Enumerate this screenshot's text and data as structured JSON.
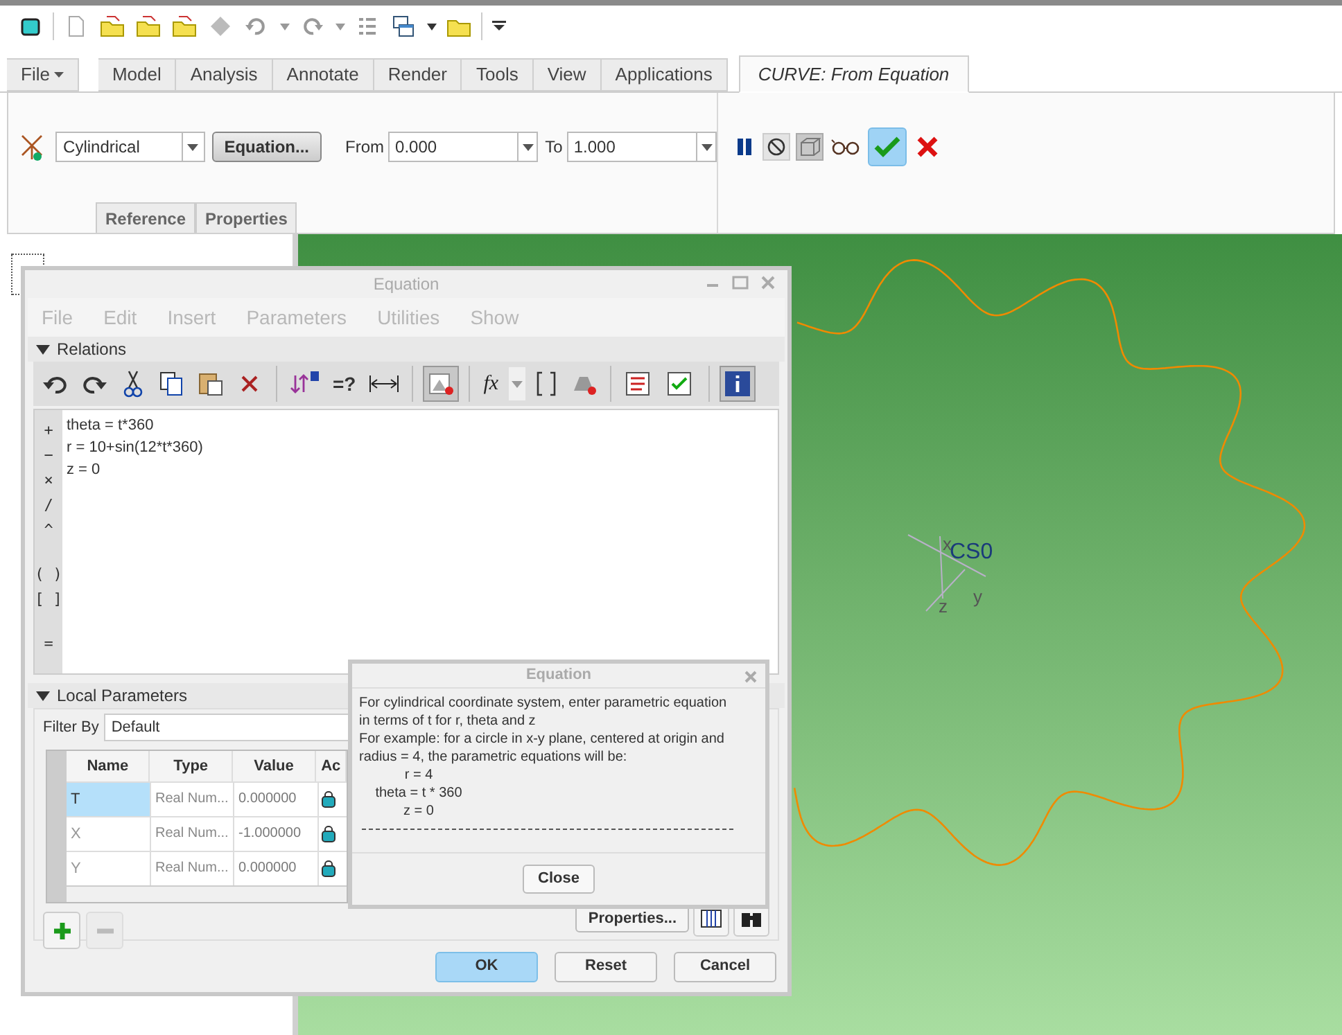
{
  "ribbon": {
    "tabs": [
      {
        "label": "File",
        "kind": "menu",
        "selected": false
      },
      {
        "label": "Model",
        "kind": "tab",
        "selected": false
      },
      {
        "label": "Analysis",
        "kind": "tab",
        "selected": false
      },
      {
        "label": "Annotate",
        "kind": "tab",
        "selected": false
      },
      {
        "label": "Render",
        "kind": "tab",
        "selected": false
      },
      {
        "label": "Tools",
        "kind": "tab",
        "selected": false
      },
      {
        "label": "View",
        "kind": "tab",
        "selected": false
      },
      {
        "label": "Applications",
        "kind": "tab",
        "selected": false
      },
      {
        "label": "CURVE: From Equation",
        "kind": "tab",
        "selected": true
      }
    ],
    "coordinate_system": {
      "value": "Cylindrical"
    },
    "equation_button": "Equation...",
    "from": {
      "label": "From",
      "value": "0.000"
    },
    "to": {
      "label": "To",
      "value": "1.000"
    },
    "panel_tabs": [
      "Reference",
      "Properties"
    ]
  },
  "equation_dialog": {
    "title": "Equation",
    "menu": [
      {
        "label": "File",
        "disabled": true
      },
      {
        "label": "Edit",
        "disabled": true
      },
      {
        "label": "Insert",
        "disabled": true
      },
      {
        "label": "Parameters",
        "disabled": true
      },
      {
        "label": "Utilities",
        "disabled": true
      },
      {
        "label": "Show",
        "disabled": true
      }
    ],
    "relations": {
      "label": "Relations",
      "expanded": true,
      "toolbar_texts": [
        "=?",
        "fx"
      ],
      "lines": [
        "theta = t*360",
        "r = 10+sin(12*t*360)",
        "z = 0"
      ],
      "operators": [
        "+",
        "−",
        "×",
        "/",
        "^",
        "( )",
        "[ ]",
        "="
      ]
    },
    "local_parameters": {
      "label": "Local Parameters",
      "expanded": true,
      "filter_label": "Filter By",
      "filter_value": "Default",
      "columns": [
        "Name",
        "Type",
        "Value",
        "Ac"
      ],
      "rows": [
        {
          "name": "T",
          "type": "Real Num...",
          "value": "0.000000",
          "selected": true
        },
        {
          "name": "X",
          "type": "Real Num...",
          "value": "-1.000000",
          "selected": false
        },
        {
          "name": "Y",
          "type": "Real Num...",
          "value": "0.000000",
          "selected": false
        }
      ],
      "properties_button": "Properties..."
    },
    "buttons": [
      {
        "label": "OK",
        "kind": "primary"
      },
      {
        "label": "Reset",
        "kind": "normal"
      },
      {
        "label": "Cancel",
        "kind": "normal"
      }
    ]
  },
  "help_popup": {
    "title": "Equation",
    "lines": [
      {
        "kind": "text",
        "text": "For cylindrical coordinate system, enter parametric equation in terms of t for r, theta and z"
      },
      {
        "kind": "text",
        "text": "For example: for a circle in x-y plane, centered at origin and radius = 4, the parametric equations will be:"
      },
      {
        "kind": "example",
        "text": "r = 4"
      },
      {
        "kind": "example",
        "text": "theta = t * 360"
      },
      {
        "kind": "example",
        "text": "z = 0"
      }
    ],
    "close_button": "Close"
  },
  "viewport": {
    "csys_label": "CS0",
    "axes": [
      "x",
      "y",
      "z"
    ]
  }
}
